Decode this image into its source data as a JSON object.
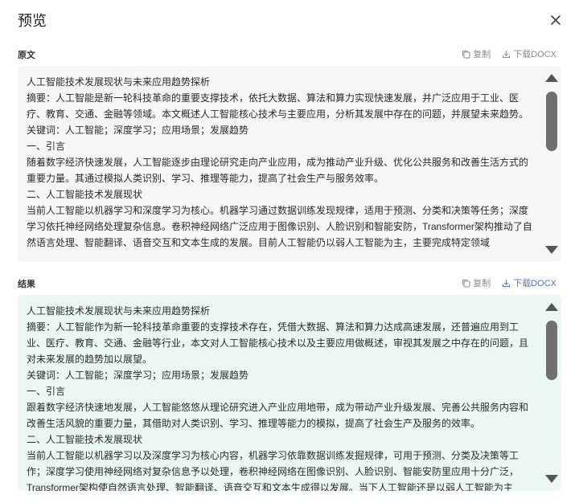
{
  "dialog": {
    "title": "预览",
    "close_icon": "close-icon"
  },
  "colors": {
    "accent": "#4a72e8",
    "original_bg": "#f4f6f8",
    "result_bg": "#eaf8f1"
  },
  "original": {
    "label": "原文",
    "copy_label": "复制",
    "download_label": "下载DOCX",
    "scroll_position": 0.1,
    "paragraphs": [
      "人工智能技术发展现状与未来应用趋势探析",
      "摘要：人工智能是新一轮科技革命的重要支撑技术，依托大数据、算法和算力实现快速发展，并广泛应用于工业、医疗、教育、交通、金融等领域。本文概述人工智能核心技术与主要应用，分析其发展中存在的问题，并展望未来趋势。",
      "关键词：人工智能；深度学习；应用场景；发展趋势",
      "一、引言",
      "随着数字经济快速发展，人工智能逐步由理论研究走向产业应用，成为推动产业升级、优化公共服务和改善生活方式的重要力量。其通过模拟人类识别、学习、推理等能力，提高了社会生产与服务效率。",
      "二、人工智能技术发展现状",
      "当前人工智能以机器学习和深度学习为核心。机器学习通过数据训练发现规律，适用于预测、分类和决策等任务；深度学习依托神经网络处理复杂信息。卷积神经网络广泛应用于图像识别、人脸识别和智能安防，Transformer架构推动了自然语言处理、智能翻译、语音交互和文本生成的发展。目前人工智能仍以弱人工智能为主，主要完成特定领域"
    ]
  },
  "result": {
    "label": "结果",
    "copy_label": "复制",
    "download_label": "下载DOCX",
    "scroll_position": 0.1,
    "paragraphs": [
      "人工智能技术发展现状与未来应用趋势探析",
      "摘要：人工智能作为新一轮科技革命重要的支撑技术存在，凭借大数据、算法和算力达成高速发展，还普遍应用到工业、医疗、教育、交通、金融等行业，本文对人工智能核心技术以及主要应用做概述，审视其发展之中存在的问题，且对未来发展的趋势加以展望。",
      "关键词：人工智能；深度学习；应用场景；发展趋势",
      "一、引言",
      "跟着数字经济快速地发展，人工智能悠悠从理论研究进入产业应用地带，成为带动产业升级发展、完善公共服务内容和改善生活风貌的重要力量，其借助对人类识别、学习、推理等能力的模拟，提高了社会生产及服务的效率。",
      "二、人工智能技术发展现状",
      "当前人工智能以机器学习以及深度学习为核心内容，机器学习依靠数据训练发掘规律，可用于预测、分类及决策等工作；深度学习使用神经网络对复杂信息予以处理，卷积神经网络在图像识别、人脸识别、智能安防里应用十分广泛，Transformer架构使自然语言处理、智能翻译、语音交互和文本生成得以发展。当下人工智能还是以弱人工智能为主"
    ]
  }
}
